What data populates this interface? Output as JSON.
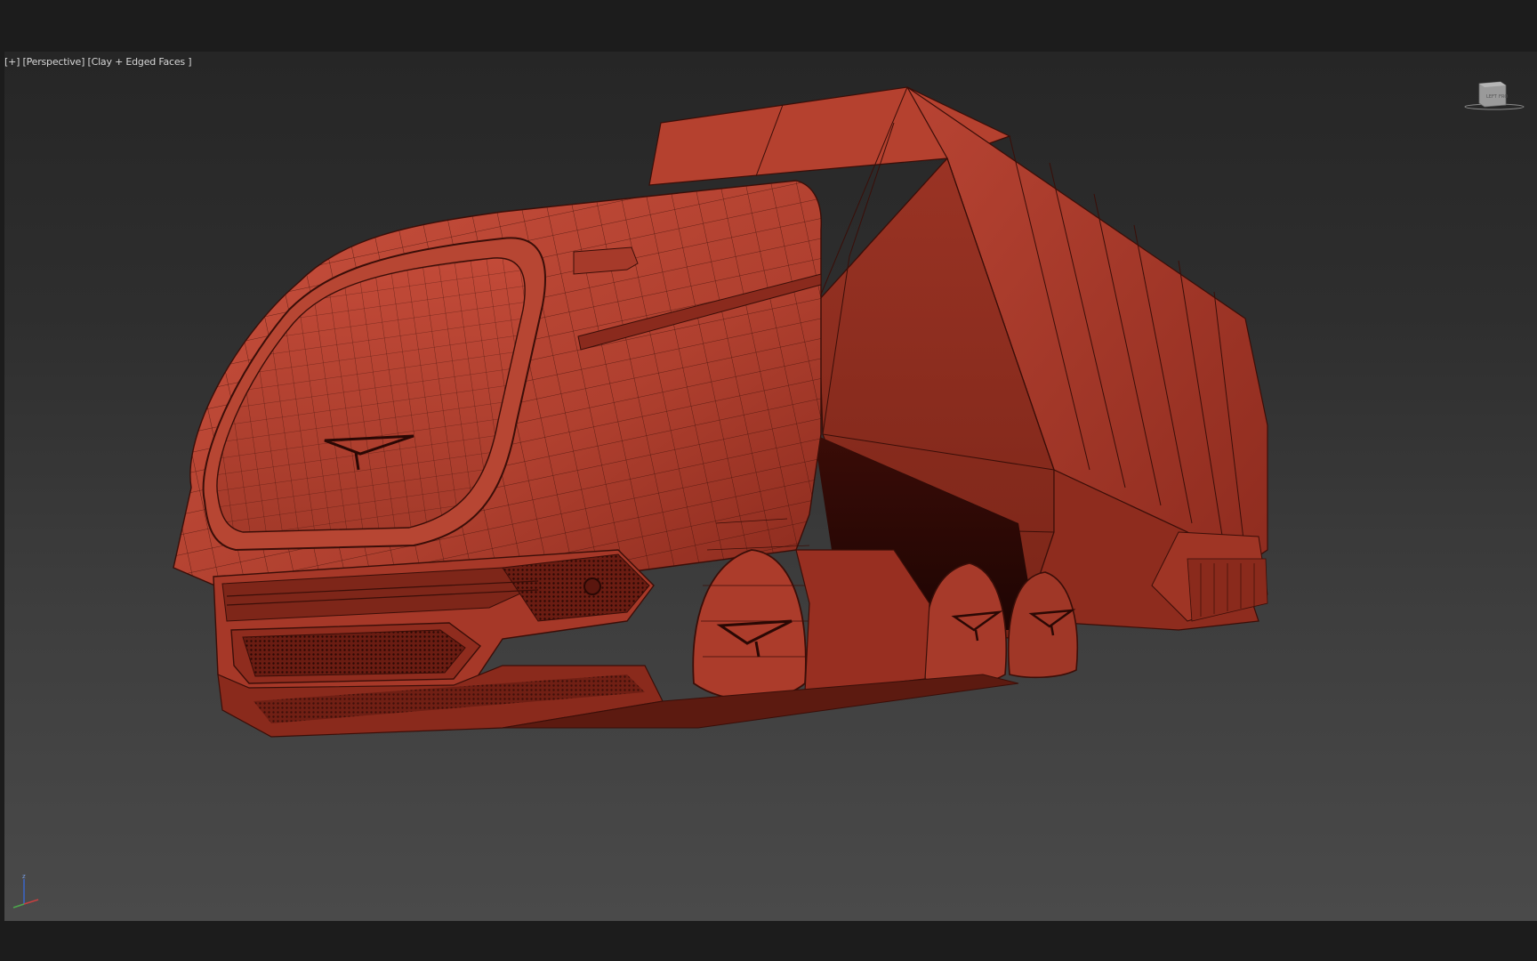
{
  "viewport": {
    "label_plus": "[+]",
    "label_view": "[Perspective]",
    "label_shading": "[Clay + Edged Faces ]"
  },
  "viewcube": {
    "face_left": "LEFT",
    "face_front": "FRO"
  },
  "axis": {
    "z_label": "z"
  },
  "colors": {
    "model_base": "#b2402f",
    "model_light": "#c9503d",
    "model_dark": "#6e1f15",
    "edge": "#3a0e08",
    "background_top": "#262626",
    "background_bottom": "#4a4a4a"
  }
}
